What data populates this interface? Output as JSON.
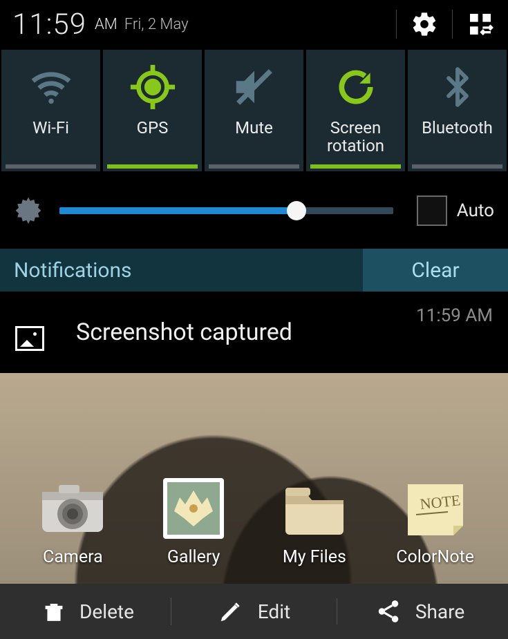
{
  "status": {
    "time": "11:59",
    "ampm": "AM",
    "date": "Fri, 2 May"
  },
  "toggles": [
    {
      "label": "Wi-Fi",
      "active": false
    },
    {
      "label": "GPS",
      "active": true
    },
    {
      "label": "Mute",
      "active": false
    },
    {
      "label": "Screen rotation",
      "active": true
    },
    {
      "label": "Bluetooth",
      "active": false
    }
  ],
  "brightness": {
    "value_percent": 71,
    "auto_label": "Auto",
    "auto_checked": false
  },
  "notif_header": {
    "title": "Notifications",
    "clear": "Clear"
  },
  "notifications": [
    {
      "title": "Screenshot captured",
      "time": "11:59 AM"
    }
  ],
  "home_apps": [
    {
      "label": "Camera",
      "icon": "camera"
    },
    {
      "label": "Gallery",
      "icon": "gallery"
    },
    {
      "label": "My Files",
      "icon": "folder"
    },
    {
      "label": "ColorNote",
      "icon": "note"
    }
  ],
  "actions": {
    "delete": "Delete",
    "edit": "Edit",
    "share": "Share"
  }
}
